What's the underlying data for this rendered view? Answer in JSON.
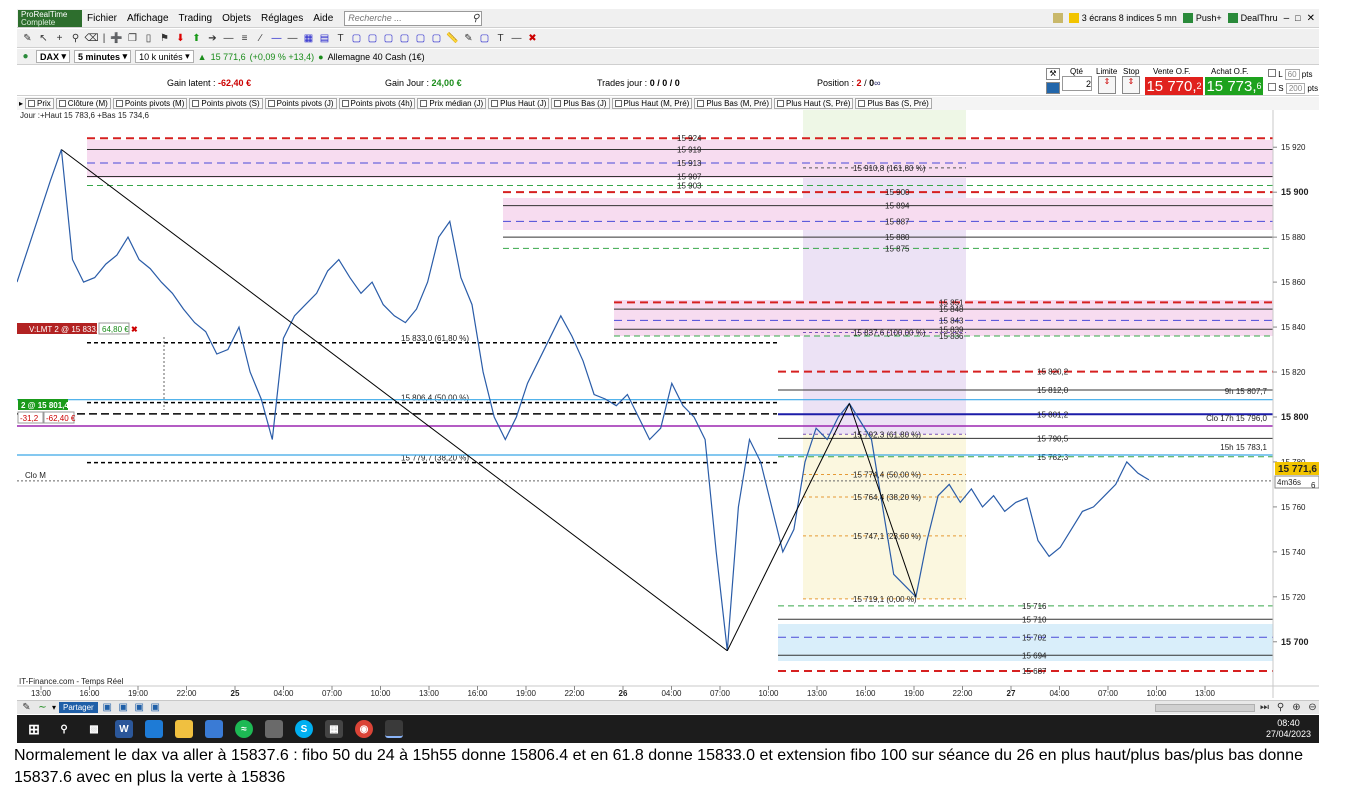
{
  "menubar": {
    "logo_line1": "ProRealTime",
    "logo_line2": "Complete",
    "items": [
      "Fichier",
      "Affichage",
      "Trading",
      "Objets",
      "Réglages",
      "Aide"
    ],
    "search_placeholder": "Recherche ...",
    "layout_label": "3 écrans 8 indices 5 mn",
    "push_label": "Push+",
    "dealthru_label": "DealThru"
  },
  "instrument": {
    "symbol": "DAX",
    "timeframe": "5 minutes",
    "units": "10 k unités",
    "price": "15 771,6",
    "change": "(+0,09 % +13,4)",
    "name": "Allemagne 40 Cash (1€)"
  },
  "orderbar": {
    "latent_label": "Gain latent :",
    "latent_value": "-62,40 €",
    "day_label": "Gain Jour :",
    "day_value": "24,00 €",
    "trades_label": "Trades jour :",
    "trades_value": "0 / 0 / 0",
    "position_label": "Position :",
    "position_value": "2",
    "position_zero": "0",
    "qty_label": "Qté",
    "qty_value": "2",
    "limit_label": "Limite",
    "stop_label": "Stop",
    "sell_label": "Vente O.F.",
    "sell_price": "15 770,",
    "sell_sup": "2",
    "buy_label": "Achat O.F.",
    "buy_price": "15 773,",
    "buy_sup": "6",
    "l_label": "L",
    "l_pts": "60",
    "s_label": "S",
    "s_pts": "200",
    "pts": "pts"
  },
  "chips": [
    "Prix",
    "Clôture (M)",
    "Points pivots (M)",
    "Points pivots (S)",
    "Points pivots (J)",
    "Points pivots (4h)",
    "Prix médian (J)",
    "Plus Haut (J)",
    "Plus Bas (J)",
    "Plus Haut (M, Pré)",
    "Plus Bas (M, Pré)",
    "Plus Haut (S, Pré)",
    "Plus Bas (S, Pré)"
  ],
  "chart_data": {
    "type": "line",
    "subtitle": "Jour :+Haut 15 783,6 +Bas 15 734,6",
    "ylim": [
      15683,
      15933
    ],
    "y_ticks": [
      15700,
      15720,
      15740,
      15760,
      15780,
      15800,
      15820,
      15840,
      15860,
      15880,
      15900,
      15920
    ],
    "y_tick_labels": [
      "15 700",
      "15 720",
      "15 740",
      "15 760",
      "15 780",
      "15 800",
      "15 820",
      "15 840",
      "15 860",
      "15 880",
      "15 900",
      "15 920"
    ],
    "x_ticks": [
      "13:00",
      "16:00",
      "19:00",
      "22:00",
      "25",
      "04:00",
      "07:00",
      "10:00",
      "13:00",
      "16:00",
      "19:00",
      "22:00",
      "26",
      "04:00",
      "07:00",
      "10:00",
      "13:00",
      "16:00",
      "19:00",
      "22:00",
      "27",
      "04:00",
      "07:00",
      "10:00",
      "13:00"
    ],
    "series": [
      {
        "values": [
          15860,
          15875,
          15890,
          15905,
          15919,
          15870,
          15860,
          15862,
          15868,
          15872,
          15880,
          15870,
          15866,
          15860,
          15855,
          15848,
          15842,
          15838,
          15828,
          15830,
          15840,
          15820,
          15808,
          15790,
          15835,
          15845,
          15850,
          15855,
          15865,
          15870,
          15862,
          15855,
          15860,
          15850,
          15845,
          15842,
          15848,
          15860,
          15880,
          15887,
          15862,
          15850,
          15820,
          15800,
          15790,
          15800,
          15815,
          15825,
          15835,
          15845,
          15836,
          15825,
          15810,
          15808,
          15805,
          15810,
          15800,
          15790,
          15795,
          15815,
          15805,
          15800,
          15790,
          15740,
          15696,
          15760,
          15790,
          15780,
          15760,
          15740,
          15750,
          15780,
          15795,
          15790,
          15800,
          15806,
          15798,
          15790,
          15760,
          15730,
          15725,
          15720,
          15745,
          15765,
          15770,
          15762,
          15768,
          15760,
          15765,
          15758,
          15762,
          15764,
          15745,
          15738,
          15742,
          15750,
          15758,
          15760,
          15765,
          15770,
          15780,
          15775,
          15772
        ]
      }
    ],
    "watermark": "IT-Finance.com - Temps Réel"
  },
  "chart_labels": {
    "levels": [
      "15 924",
      "15 919",
      "15 913",
      "15 907",
      "15 903",
      "15 900",
      "15 894",
      "15 887",
      "15 880",
      "15 875",
      "15 851",
      "15 848",
      "15 843",
      "15 839",
      "15 836",
      "15 820,2",
      "15 812,0",
      "15 801,2",
      "15 790,5",
      "15 782,3",
      "15 716",
      "15 710",
      "15 702",
      "15 694",
      "15 687"
    ],
    "fibo_a": [
      "15 833,0 (61,80 %)",
      "15 806,4 (50,00 %)",
      "15 779,7 (38,20 %)"
    ],
    "fibo_b": [
      "15 910,8 (161,80 %)",
      "15 837,6 (100,00 %)",
      "15 792,3 (61,80 %)",
      "15 774,4 (50,00 %)",
      "15 764,4 (38,20 %)",
      "15 747,1 (23,60 %)",
      "15 719,1 (0,00 %)"
    ],
    "right_notes": [
      "9h 15 807,7",
      "Clo 17h 15 796,0",
      "15h 15 783,1"
    ],
    "clo_m": "Clo M",
    "order_tag": "V:LMT 2 @ 15 833,8",
    "order_gain": "64,80 €",
    "pos_tag": "2 @ 15 801,4",
    "pos_pts": "-31,2",
    "pos_eur": "-62,40 €",
    "last_price": "15 771,6",
    "countdown": "4m36s",
    "countdown_sub": "6"
  },
  "scrollbar": {
    "share_label": "Partager"
  },
  "taskbar": {
    "time": "08:40",
    "date": "27/04/2023"
  },
  "caption": "Normalement le dax va aller à 15837.6 : fibo 50 du 24 à 15h55 donne 15806.4 et en 61.8 donne 15833.0 et extension fibo 100 sur séance du 26 en  plus haut/plus bas/plus bas donne 15837.6 avec en plus la verte à 15836"
}
